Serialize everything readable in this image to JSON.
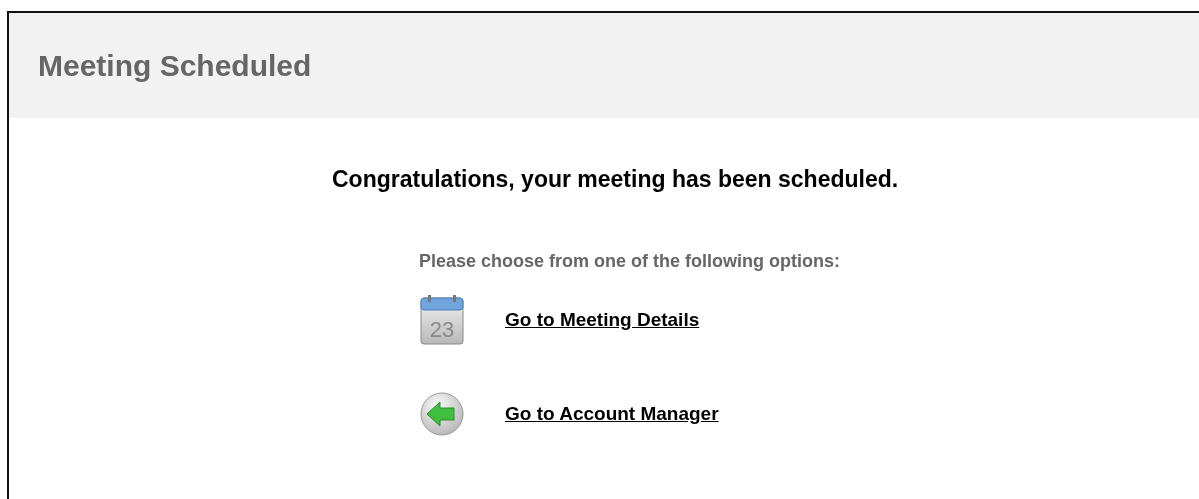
{
  "header": {
    "title": "Meeting Scheduled"
  },
  "message": "Congratulations, your meeting has been scheduled.",
  "prompt": "Please choose from one of the following options:",
  "options": [
    {
      "kind": "calendar",
      "label": "Go to Meeting Details",
      "calendar_day": "23"
    },
    {
      "kind": "back",
      "label": "Go to Account Manager"
    }
  ]
}
